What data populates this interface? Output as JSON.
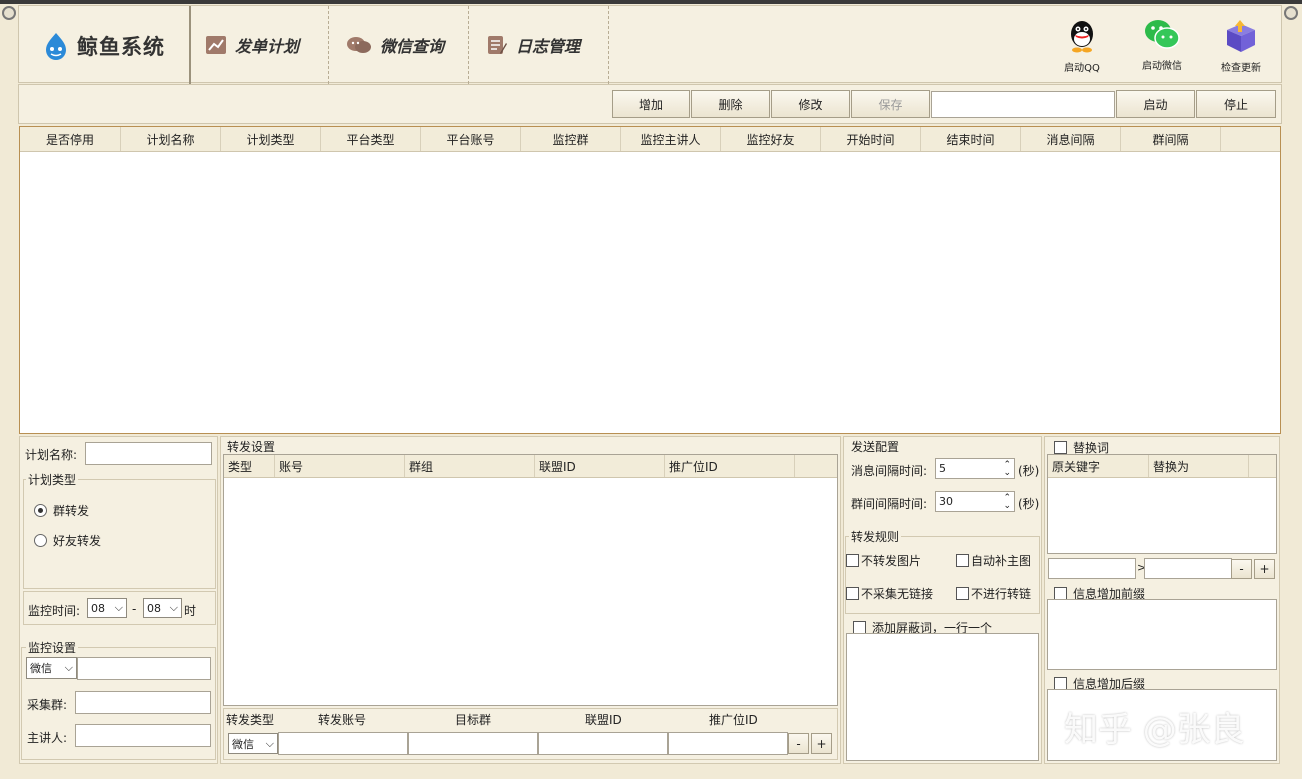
{
  "app": {
    "name": "鲸鱼系统"
  },
  "nav": [
    {
      "label": "发单计划",
      "icon": "chart-icon"
    },
    {
      "label": "微信查询",
      "icon": "wechat-chat-icon"
    },
    {
      "label": "日志管理",
      "icon": "log-icon"
    }
  ],
  "tools": [
    {
      "label": "启动QQ",
      "icon": "qq-icon"
    },
    {
      "label": "启动微信",
      "icon": "wechat-icon"
    },
    {
      "label": "检查更新",
      "icon": "update-box-icon"
    }
  ],
  "toolbar": {
    "add": "增加",
    "delete": "删除",
    "modify": "修改",
    "save": "保存",
    "start": "启动",
    "stop": "停止",
    "field_value": ""
  },
  "main_table": {
    "columns": [
      "是否停用",
      "计划名称",
      "计划类型",
      "平台类型",
      "平台账号",
      "监控群",
      "监控主讲人",
      "监控好友",
      "开始时间",
      "结束时间",
      "消息间隔",
      "群间隔"
    ]
  },
  "plan": {
    "name_label": "计划名称:",
    "name_value": "",
    "type_legend": "计划类型",
    "type_options": [
      "群转发",
      "好友转发"
    ],
    "monitor_time_label": "监控时间:",
    "start_hour": "08",
    "dash": "-",
    "end_hour": "08",
    "hour_suffix": "时"
  },
  "monitor": {
    "legend": "监控设置",
    "platform": "微信",
    "collect_group_label": "采集群:",
    "speaker_label": "主讲人:"
  },
  "forward": {
    "legend": "转发设置",
    "columns": [
      "类型",
      "账号",
      "群组",
      "联盟ID",
      "推广位ID"
    ],
    "footer_labels": [
      "转发类型",
      "转发账号",
      "目标群",
      "联盟ID",
      "推广位ID"
    ],
    "type_value": "微信",
    "minus": "-",
    "plus": "+"
  },
  "send": {
    "legend": "发送配置",
    "msg_interval_label": "消息间隔时间:",
    "msg_interval_value": "5",
    "group_interval_label": "群间间隔时间:",
    "group_interval_value": "30",
    "unit": "(秒)"
  },
  "rules": {
    "legend": "转发规则",
    "options": [
      "不转发图片",
      "自动补主图",
      "不采集无链接",
      "不进行转链"
    ]
  },
  "block": {
    "legend": "添加屏蔽词，一行一个"
  },
  "replace": {
    "legend": "替换词",
    "columns": [
      "原关键字",
      "替换为"
    ],
    "arrow": ">",
    "minus": "-",
    "plus": "+"
  },
  "prefix": {
    "legend": "信息增加前缀"
  },
  "suffix": {
    "legend": "信息增加后缀"
  },
  "watermark": "知乎 @张良",
  "colors": {
    "accent_border": "#b88f52",
    "panel": "#f5f0e1",
    "background": "#f1ead6"
  }
}
